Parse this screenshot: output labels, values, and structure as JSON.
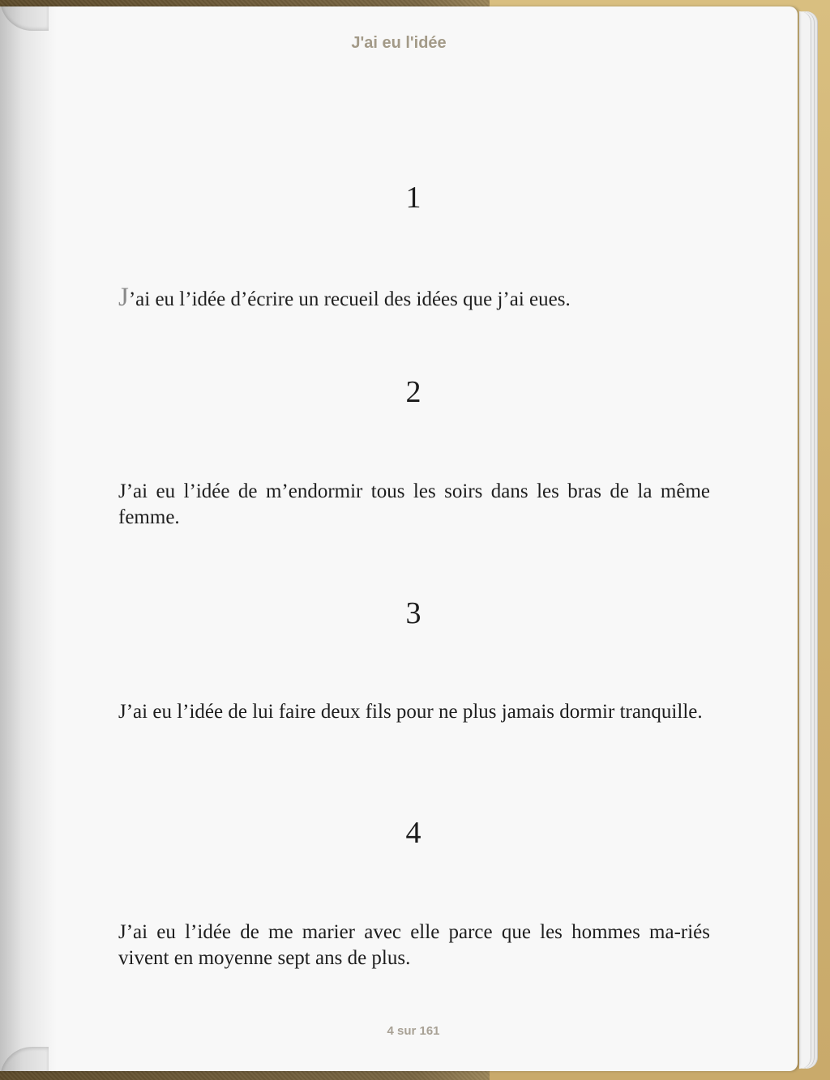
{
  "header": {
    "title": "J'ai eu l'idée"
  },
  "sections": [
    {
      "number": "1",
      "dropcap": "J",
      "text_rest": "’ai eu l’idée d’écrire un recueil des idées que j’ai eues."
    },
    {
      "number": "2",
      "text": "J’ai eu l’idée de m’endormir tous les soirs dans les bras de la même femme."
    },
    {
      "number": "3",
      "text": "J’ai eu l’idée de lui faire deux fils pour ne plus jamais dormir tranquille."
    },
    {
      "number": "4",
      "text": "J’ai eu l’idée de me marier avec elle parce que les hommes ma-riés vivent en moyenne sept ans de plus."
    }
  ],
  "footer": {
    "page_counter": "4 sur 161"
  }
}
